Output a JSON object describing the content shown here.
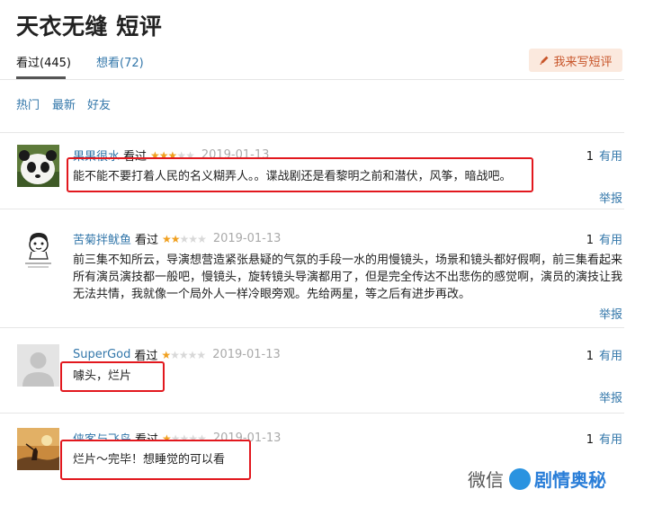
{
  "page": {
    "title": "天衣无缝 短评"
  },
  "tabs": [
    {
      "label": "看过(445)",
      "active": true
    },
    {
      "label": "想看(72)",
      "active": false
    }
  ],
  "write_button": {
    "label": "我来写短评",
    "icon": "pen-icon"
  },
  "sort_options": [
    "热门",
    "最新",
    "好友"
  ],
  "comments": [
    {
      "author": "果果很水",
      "status": "看过",
      "stars": 3,
      "date": "2019-01-13",
      "useful_count": "1",
      "useful_label": "有用",
      "report_label": "举报",
      "text": "能不能不要打着人民的名义糊弄人。。谍战剧还是看黎明之前和潜伏，风筝，暗战吧。"
    },
    {
      "author": "苦菊拌鱿鱼",
      "status": "看过",
      "stars": 2,
      "date": "2019-01-13",
      "useful_count": "1",
      "useful_label": "有用",
      "report_label": "举报",
      "text_lines": [
        "前三集不知所云，导演想营造紧张悬疑的气氛的手段一水的用慢镜头，场景和镜头都好假啊，前三集看起来",
        "所有演员演技都一般吧，慢镜头，旋转镜头导演都用了，但是完全传达不出悲伤的感觉啊，演员的演技让我",
        "无法共情，我就像一个局外人一样冷眼旁观。先给两星，等之后有进步再改。"
      ]
    },
    {
      "author": "SuperGod",
      "status": "看过",
      "stars": 1,
      "date": "2019-01-13",
      "useful_count": "1",
      "useful_label": "有用",
      "report_label": "举报",
      "text": "噱头，烂片"
    },
    {
      "author": "侠客与飞鸟",
      "status": "看过",
      "stars": 1,
      "date": "2019-01-13",
      "useful_count": "1",
      "useful_label": "有用",
      "text": "烂片～完毕！想睡觉的可以看"
    }
  ],
  "watermark": {
    "prefix": "微信",
    "name": "剧情奥秘"
  },
  "colors": {
    "link": "#3377aa",
    "star": "#f0a020",
    "highlight_box": "#e2181e",
    "write_button_bg": "#fbe9de"
  }
}
